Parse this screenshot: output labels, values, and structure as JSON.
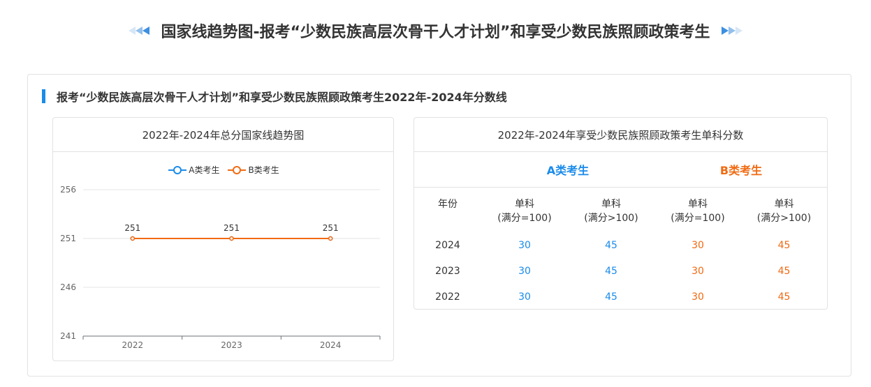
{
  "page_title": "国家线趋势图-报考“少数民族高层次骨干人才计划”和享受少数民族照顾政策考生",
  "section_title": "报考“少数民族高层次骨干人才计划”和享受少数民族照顾政策考生2022年-2024年分数线",
  "colors": {
    "accent_blue": "#1a8bea",
    "accent_orange": "#f06a12"
  },
  "chart_panel": {
    "title": "2022年-2024年总分国家线趋势图"
  },
  "table_panel": {
    "title": "2022年-2024年享受少数民族照顾政策考生单科分数",
    "group_a": "A类考生",
    "group_b": "B类考生",
    "headers": {
      "year": "年份",
      "col1": [
        "单科",
        "(满分=100)"
      ],
      "col2": [
        "单科",
        "(满分>100)"
      ],
      "col3": [
        "单科",
        "(满分=100)"
      ],
      "col4": [
        "单科",
        "(满分>100)"
      ]
    },
    "rows": [
      {
        "year": "2024",
        "a1": "30",
        "a2": "45",
        "b1": "30",
        "b2": "45"
      },
      {
        "year": "2023",
        "a1": "30",
        "a2": "45",
        "b1": "30",
        "b2": "45"
      },
      {
        "year": "2022",
        "a1": "30",
        "a2": "45",
        "b1": "30",
        "b2": "45"
      }
    ]
  },
  "chart_data": {
    "type": "line",
    "x": [
      "2022",
      "2023",
      "2024"
    ],
    "series": [
      {
        "name": "A类考生",
        "color": "#1a8bea",
        "values": [
          251,
          251,
          251
        ]
      },
      {
        "name": "B类考生",
        "color": "#f06a12",
        "values": [
          251,
          251,
          251
        ]
      }
    ],
    "ylim": [
      241,
      256
    ],
    "yticks": [
      241,
      246,
      251,
      256
    ],
    "data_labels": true,
    "grid": true,
    "legend": "top-center"
  }
}
